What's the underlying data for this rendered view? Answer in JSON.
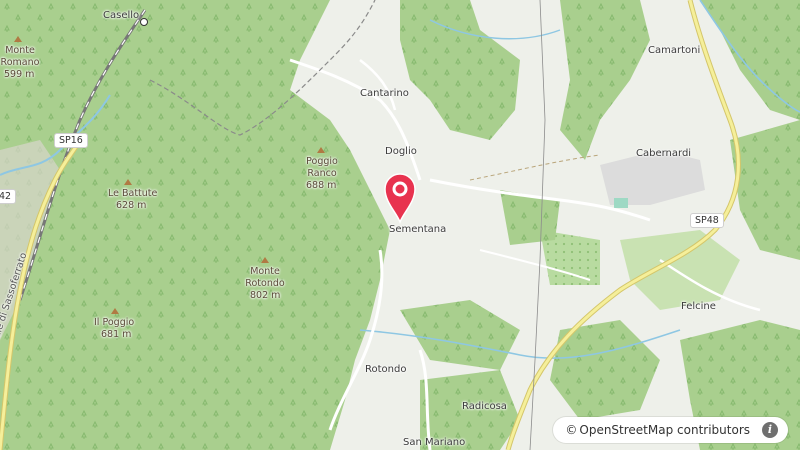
{
  "map": {
    "places": [
      {
        "id": "casello",
        "name": "Casello"
      },
      {
        "id": "cantarino",
        "name": "Cantarino"
      },
      {
        "id": "camartoni",
        "name": "Camartoni"
      },
      {
        "id": "doglio",
        "name": "Doglio"
      },
      {
        "id": "cabernardi",
        "name": "Cabernardi"
      },
      {
        "id": "sementana",
        "name": "Sementana"
      },
      {
        "id": "felcine",
        "name": "Felcine"
      },
      {
        "id": "rotondo",
        "name": "Rotondo"
      },
      {
        "id": "radicosa",
        "name": "Radicosa"
      },
      {
        "id": "san-mariano",
        "name": "San Mariano"
      }
    ],
    "peaks": [
      {
        "id": "monte-romano",
        "name": "Monte\nRomano",
        "elevation": "599 m"
      },
      {
        "id": "poggio-ranco",
        "name": "Poggio\nRanco",
        "elevation": "688 m"
      },
      {
        "id": "le-battute",
        "name": "Le Battute",
        "elevation": "628 m"
      },
      {
        "id": "monte-rotondo",
        "name": "Monte\nRotondo",
        "elevation": "802 m"
      },
      {
        "id": "il-poggio",
        "name": "Il Poggio",
        "elevation": "681 m"
      }
    ],
    "roads": [
      {
        "id": "sp16",
        "label": "SP16"
      },
      {
        "id": "sp48",
        "label": "SP48"
      },
      {
        "id": "route-42",
        "label": "42"
      },
      {
        "id": "provinciale",
        "label": "vinciale di Sassoferrato"
      }
    ],
    "marker": {
      "label": "Sementana",
      "color": "#e8334f"
    },
    "attribution": {
      "symbol": "©",
      "text": "OpenStreetMap contributors",
      "info_icon": "i"
    },
    "colors": {
      "forest": "#a9cf8e",
      "forest_dark": "#8fbf76",
      "land": "#eef0ea",
      "water": "#8ec7e3",
      "road_yellow": "#f5ef9a",
      "road_outline": "#d4c66a",
      "rail": "#777777"
    }
  }
}
